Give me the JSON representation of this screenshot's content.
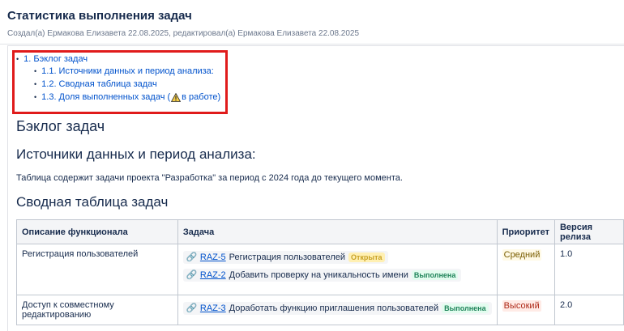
{
  "page": {
    "title": "Статистика выполнения задач",
    "meta": "Создал(а) Ермакова Елизавета 22.08.2025, редактировал(а) Ермакова Елизавета 22.08.2025"
  },
  "toc": {
    "item1": "1. Бэклог задач",
    "item1_1": "1.1. Источники данных и период анализа:",
    "item1_2": "1.2. Сводная таблица задач",
    "item1_3_prefix": "1.3. Доля выполненных задач (",
    "item1_3_suffix": "в работе)",
    "warning_icon": "warning-icon"
  },
  "sections": {
    "backlog": "Бэклог задач",
    "sources": "Источники данных и период анализа:",
    "sources_text": "Таблица содержит задачи проекта \"Разработка\" за период с 2024 года до текущего момента.",
    "summary": "Сводная таблица задач"
  },
  "table": {
    "headers": [
      "Описание функционала",
      "Задача",
      "Приоритет",
      "Версия релиза"
    ],
    "rows": [
      {
        "feature": "Регистрация пользователей",
        "tasks": [
          {
            "key": "RAZ-5",
            "title": "Регистрация пользователей",
            "status": "Открыта"
          },
          {
            "key": "RAZ-2",
            "title": "Добавить проверку на уникальность имени",
            "status": "Выполнена"
          }
        ],
        "priority": "Средний",
        "version": "1.0"
      },
      {
        "feature": "Доступ к совместному редактированию",
        "tasks": [
          {
            "key": "RAZ-3",
            "title": "Доработать функцию приглашения пользователей",
            "status": "Выполнена"
          }
        ],
        "priority": "Высокий",
        "version": "2.0"
      }
    ]
  },
  "colors": {
    "link": "#0052cc",
    "highlight_border": "#e01b1b",
    "status_open": "#fff0b3",
    "status_done": "#e3fcef"
  }
}
